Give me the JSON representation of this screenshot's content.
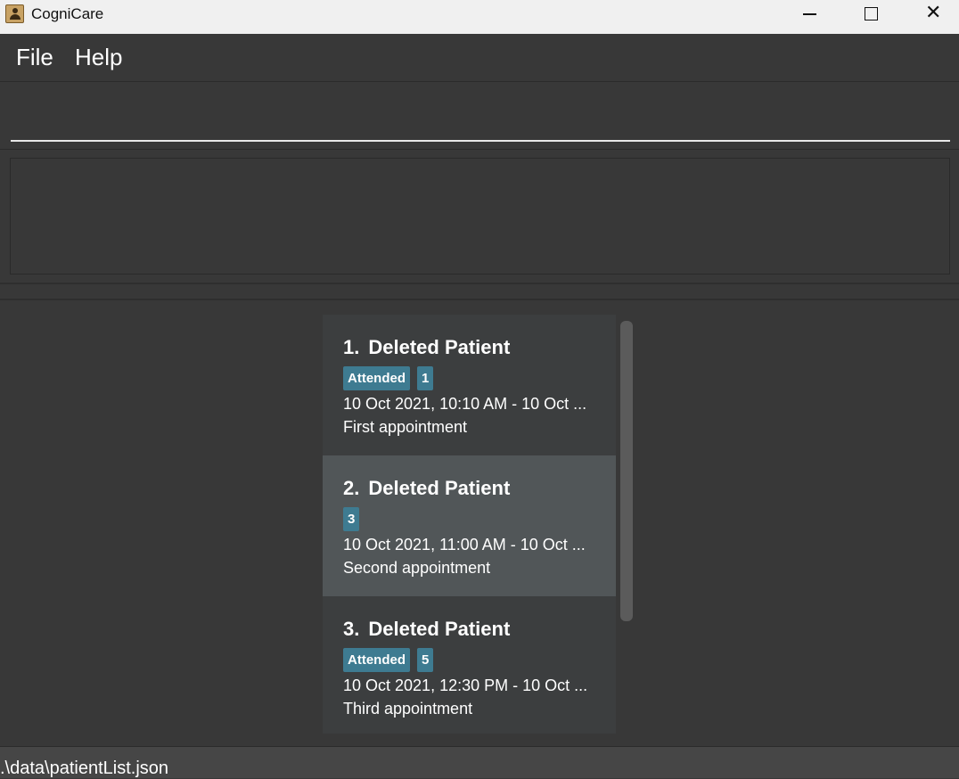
{
  "window": {
    "title": "CogniCare",
    "icon": "contact-book-icon",
    "controls": {
      "minimize": "—",
      "maximize": "□",
      "close": "✕"
    }
  },
  "menu": {
    "file_label": "File",
    "help_label": "Help"
  },
  "command_box": {
    "value": "",
    "placeholder": ""
  },
  "result_display": {
    "text": ""
  },
  "appointments": [
    {
      "index": "1.",
      "name": "Deleted Patient",
      "tags": [
        "Attended",
        "1"
      ],
      "time": "10 Oct 2021, 10:10 AM - 10 Oct ...",
      "description": "First appointment",
      "selected": false
    },
    {
      "index": "2.",
      "name": "Deleted Patient",
      "tags": [
        "3"
      ],
      "time": "10 Oct 2021, 11:00 AM - 10 Oct ...",
      "description": "Second appointment",
      "selected": true
    },
    {
      "index": "3.",
      "name": "Deleted Patient",
      "tags": [
        "Attended",
        "5"
      ],
      "time": "10 Oct 2021, 12:30 PM - 10 Oct ...",
      "description": "Third appointment",
      "selected": false
    }
  ],
  "status_bar": {
    "save_location": ".\\data\\patientList.json"
  },
  "colors": {
    "background": "#383838",
    "card": "#3c3e3f",
    "card_selected": "#515658",
    "tag": "#3e7b91",
    "status_bar": "#464646"
  }
}
